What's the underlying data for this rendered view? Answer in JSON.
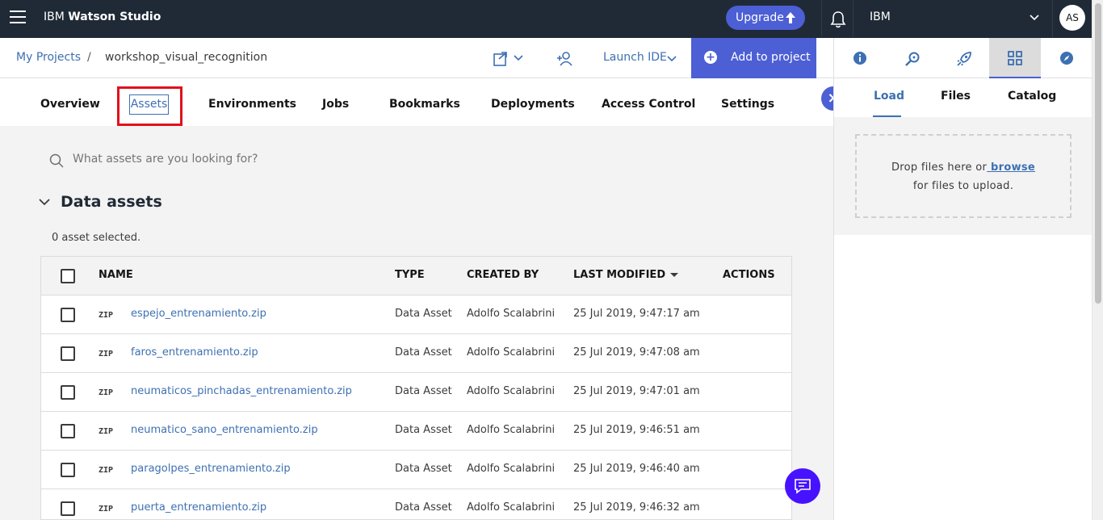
{
  "topbar": {
    "brand_prefix": "IBM ",
    "brand_name": "Watson Studio",
    "upgrade_label": "Upgrade",
    "account_name": "IBM",
    "avatar_initials": "AS"
  },
  "breadcrumb": {
    "projects_link": "My Projects",
    "separator": "/",
    "current": "workshop_visual_recognition"
  },
  "actions": {
    "launch_ide": "Launch IDE",
    "add_to_project": "Add to project"
  },
  "rail": {
    "icons": [
      "info-icon",
      "search-asset-icon",
      "rocket-icon",
      "data-grid-icon",
      "compass-icon"
    ],
    "active_index": 3
  },
  "tabs": {
    "overview": "Overview",
    "assets": "Assets",
    "environments": "Environments",
    "jobs": "Jobs",
    "bookmarks": "Bookmarks",
    "deployments": "Deployments",
    "access_control": "Access Control",
    "settings": "Settings",
    "active": "Assets"
  },
  "search": {
    "placeholder": "What assets are you looking for?"
  },
  "data_assets": {
    "title": "Data assets",
    "selected_text": "0 asset selected.",
    "columns": {
      "name": "NAME",
      "type": "TYPE",
      "created_by": "CREATED BY",
      "last_modified": "LAST MODIFIED",
      "actions": "ACTIONS"
    },
    "rows": [
      {
        "format": "ZIP",
        "name": "espejo_entrenamiento.zip",
        "type": "Data Asset",
        "created_by": "Adolfo Scalabrini",
        "modified": "25 Jul 2019, 9:47:17 am"
      },
      {
        "format": "ZIP",
        "name": "faros_entrenamiento.zip",
        "type": "Data Asset",
        "created_by": "Adolfo Scalabrini",
        "modified": "25 Jul 2019, 9:47:08 am"
      },
      {
        "format": "ZIP",
        "name": "neumaticos_pinchadas_entrenamiento.zip",
        "type": "Data Asset",
        "created_by": "Adolfo Scalabrini",
        "modified": "25 Jul 2019, 9:47:01 am"
      },
      {
        "format": "ZIP",
        "name": "neumatico_sano_entrenamiento.zip",
        "type": "Data Asset",
        "created_by": "Adolfo Scalabrini",
        "modified": "25 Jul 2019, 9:46:51 am"
      },
      {
        "format": "ZIP",
        "name": "paragolpes_entrenamiento.zip",
        "type": "Data Asset",
        "created_by": "Adolfo Scalabrini",
        "modified": "25 Jul 2019, 9:46:40 am"
      },
      {
        "format": "ZIP",
        "name": "puerta_entrenamiento.zip",
        "type": "Data Asset",
        "created_by": "Adolfo Scalabrini",
        "modified": "25 Jul 2019, 9:46:32 am"
      }
    ]
  },
  "panel": {
    "tab_load": "Load",
    "tab_files": "Files",
    "tab_catalog": "Catalog",
    "active_tab": "Load",
    "drop_text_1": "Drop files here or",
    "browse_link": " browse",
    "drop_text_2": "for files to upload."
  },
  "colors": {
    "topbar_bg": "#1f2a36",
    "accent": "#4c5fd5",
    "link": "#3d70b2",
    "highlight_box": "#e0111b",
    "chat": "#4712ff"
  }
}
